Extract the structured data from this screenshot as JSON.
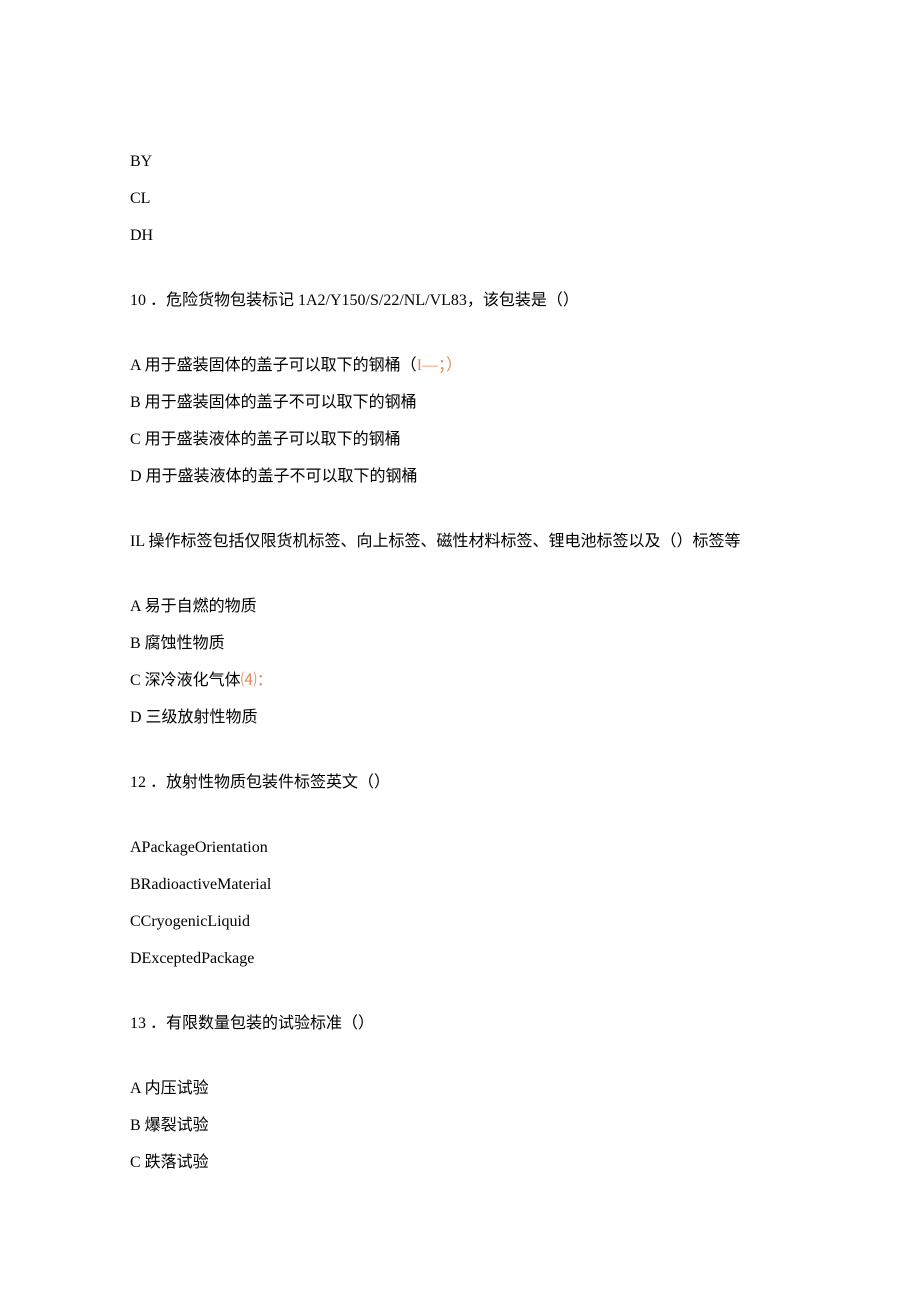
{
  "intro": [
    "BY",
    "CL",
    "DH"
  ],
  "q10": {
    "stem_prefix": "10 ．危险货物包装标记 1A2/Y150/S/22/NL/VL83，该包装是（）",
    "optA_before": "A 用于盛装固体的盖子可以取下的钢桶（",
    "optA_highlight": "I—；）",
    "optB": "B 用于盛装固体的盖子不可以取下的钢桶",
    "optC": "C 用于盛装液体的盖子可以取下的钢桶",
    "optD": "D 用于盛装液体的盖子不可以取下的钢桶"
  },
  "q11": {
    "stem": "IL 操作标签包括仅限货机标签、向上标签、磁性材料标签、锂电池标签以及（）标签等",
    "optA": "A 易于自燃的物质",
    "optB": "B 腐蚀性物质",
    "optC_before": "C 深冷液化气体",
    "optC_highlight": "⑷：",
    "optD": "D 三级放射性物质"
  },
  "q12": {
    "stem": "12 ．放射性物质包装件标签英文（）",
    "optA": "APackageOrientation",
    "optB": "BRadioactiveMaterial",
    "optC": "CCryogenicLiquid",
    "optD": "DExceptedPackage"
  },
  "q13": {
    "stem": "13 ．有限数量包装的试验标准（）",
    "optA": "A 内压试验",
    "optB": "B 爆裂试验",
    "optC": "C 跌落试验"
  }
}
